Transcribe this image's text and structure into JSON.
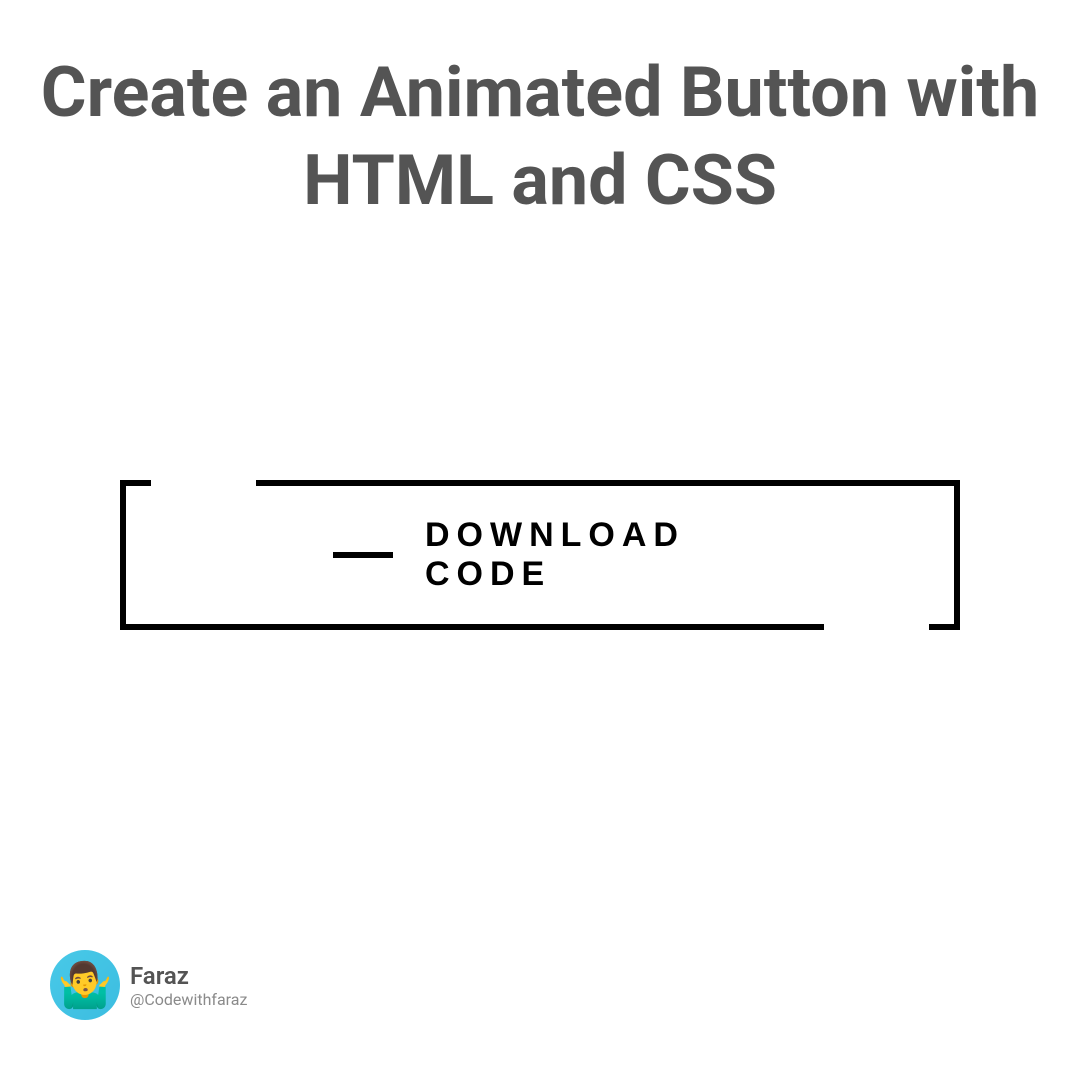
{
  "title": "Create an Animated Button with HTML and CSS",
  "button": {
    "label": "DOWNLOAD CODE"
  },
  "author": {
    "name": "Faraz",
    "handle": "@Codewithfaraz",
    "avatar_emoji": "🤷‍♂️"
  }
}
